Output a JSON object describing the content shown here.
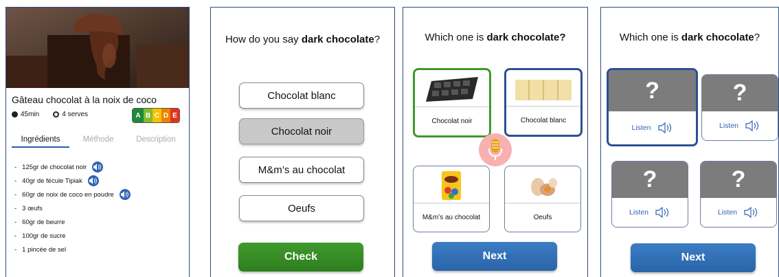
{
  "recipe": {
    "title": "Gâteau chocolat à la noix de coco",
    "time": "45min",
    "serves": "4 serves",
    "nutriscore": [
      "A",
      "B",
      "C",
      "D",
      "E"
    ],
    "tabs": [
      "Ingrédients",
      "Méthode",
      "Description"
    ],
    "ingredients": [
      {
        "dash": "-",
        "text": "125gr de chocolat noir",
        "audio": true
      },
      {
        "dash": "-",
        "text": "40gr de fécule Tipiak",
        "audio": true
      },
      {
        "dash": "-",
        "text": "60gr de noix de coco en poudre",
        "audio": true
      },
      {
        "dash": "-",
        "text": "3 œufs",
        "audio": false
      },
      {
        "dash": "-",
        "text": "60gr de beurre",
        "audio": false
      },
      {
        "dash": "-",
        "text": "100gr de sucre",
        "audio": false
      },
      {
        "dash": "-",
        "text": "1 pincée de sel",
        "audio": false
      }
    ]
  },
  "quiz1": {
    "question_prefix": "How do you say ",
    "question_bold": "dark chocolate",
    "question_suffix": "?",
    "options": [
      "Chocolat blanc",
      "Chocolat noir",
      "M&m’s au chocolat",
      "Oeufs"
    ],
    "check_label": "Check"
  },
  "quiz2": {
    "question_prefix": "Which one is ",
    "question_bold": "dark chocolate?",
    "cards": [
      "Chocolat noir",
      "Chocolat blanc",
      "M&m’s au chocolat",
      "Oeufs"
    ],
    "next_label": "Next"
  },
  "quiz3": {
    "question_prefix": "Which one is ",
    "question_bold": "dark chocolate",
    "question_suffix": "?",
    "mark": "?",
    "listen_label": "Listen",
    "next_label": "Next"
  },
  "colors": {
    "border": "#2f4a7a",
    "green": "#3d9a2a",
    "blue": "#2e63b3",
    "card_gray": "#7c7c7c"
  }
}
